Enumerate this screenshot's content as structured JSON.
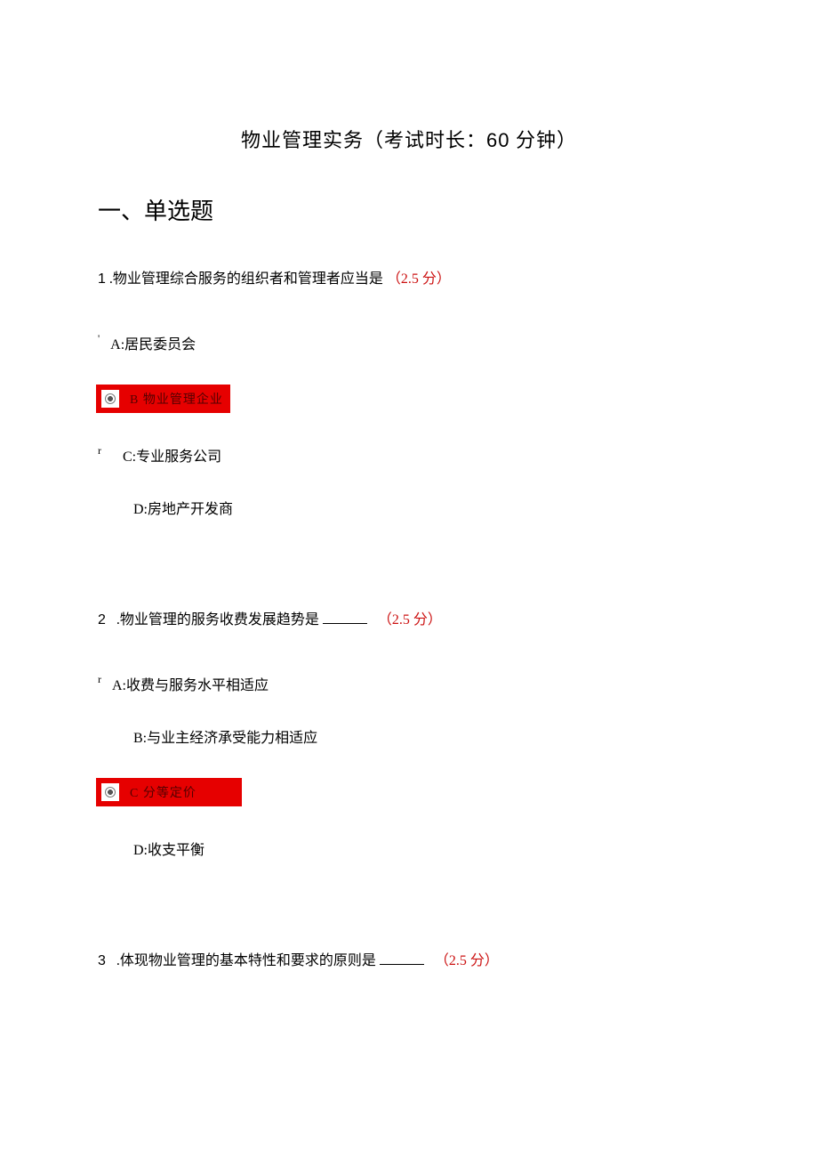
{
  "header": {
    "title_prefix": "物业管理实务（考试时长：",
    "title_minutes": "60",
    "title_suffix": " 分钟）"
  },
  "section": {
    "heading": "一、单选题"
  },
  "questions": [
    {
      "num": "1",
      "stem": ".物业管理综合服务的组织者和管理者应当是",
      "points": "（2.5 分）",
      "a_prefix": "'",
      "a": "A:居民委员会",
      "selected": "B  物业管理企业",
      "c_prefix": "r",
      "c": "C:专业服务公司",
      "d": "D:房地产开发商"
    },
    {
      "num": "2",
      "stem": ".物业管理的服务收费发展趋势是 ",
      "points": "（2.5 分）",
      "a_prefix": "r",
      "a": "A:收费与服务水平相适应",
      "b": "B:与业主经济承受能力相适应",
      "selected": "C  分等定价",
      "d": "D:收支平衡"
    },
    {
      "num": "3",
      "stem": ".体现物业管理的基本特性和要求的原则是 ",
      "points": "（2.5 分）"
    }
  ]
}
